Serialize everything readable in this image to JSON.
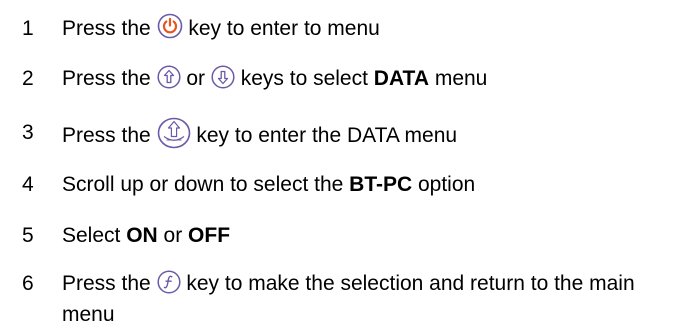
{
  "steps": [
    {
      "number": "1",
      "segments": [
        {
          "text": "Press the "
        },
        {
          "icon": "power-icon"
        },
        {
          "text": " key to enter to menu"
        }
      ]
    },
    {
      "number": "2",
      "segments": [
        {
          "text": "Press the "
        },
        {
          "icon": "up-arrow-icon"
        },
        {
          "text": " or "
        },
        {
          "icon": "down-arrow-icon"
        },
        {
          "text": " keys to select "
        },
        {
          "text": "DATA",
          "bold": true
        },
        {
          "text": " menu"
        }
      ]
    },
    {
      "number": "3",
      "segments": [
        {
          "text": "Press the "
        },
        {
          "icon": "enter-key-icon"
        },
        {
          "text": " key to enter the DATA menu"
        }
      ]
    },
    {
      "number": "4",
      "segments": [
        {
          "text": "Scroll up or down to select the "
        },
        {
          "text": "BT-PC",
          "bold": true
        },
        {
          "text": " option"
        }
      ]
    },
    {
      "number": "5",
      "segments": [
        {
          "text": "Select "
        },
        {
          "text": "ON",
          "bold": true
        },
        {
          "text": " or "
        },
        {
          "text": "OFF",
          "bold": true
        }
      ]
    },
    {
      "number": "6",
      "segments": [
        {
          "text": "Press the "
        },
        {
          "icon": "function-key-icon"
        },
        {
          "text": " key to make the selection and return to the main menu"
        }
      ]
    }
  ],
  "icon_color": "#6b5aa8"
}
